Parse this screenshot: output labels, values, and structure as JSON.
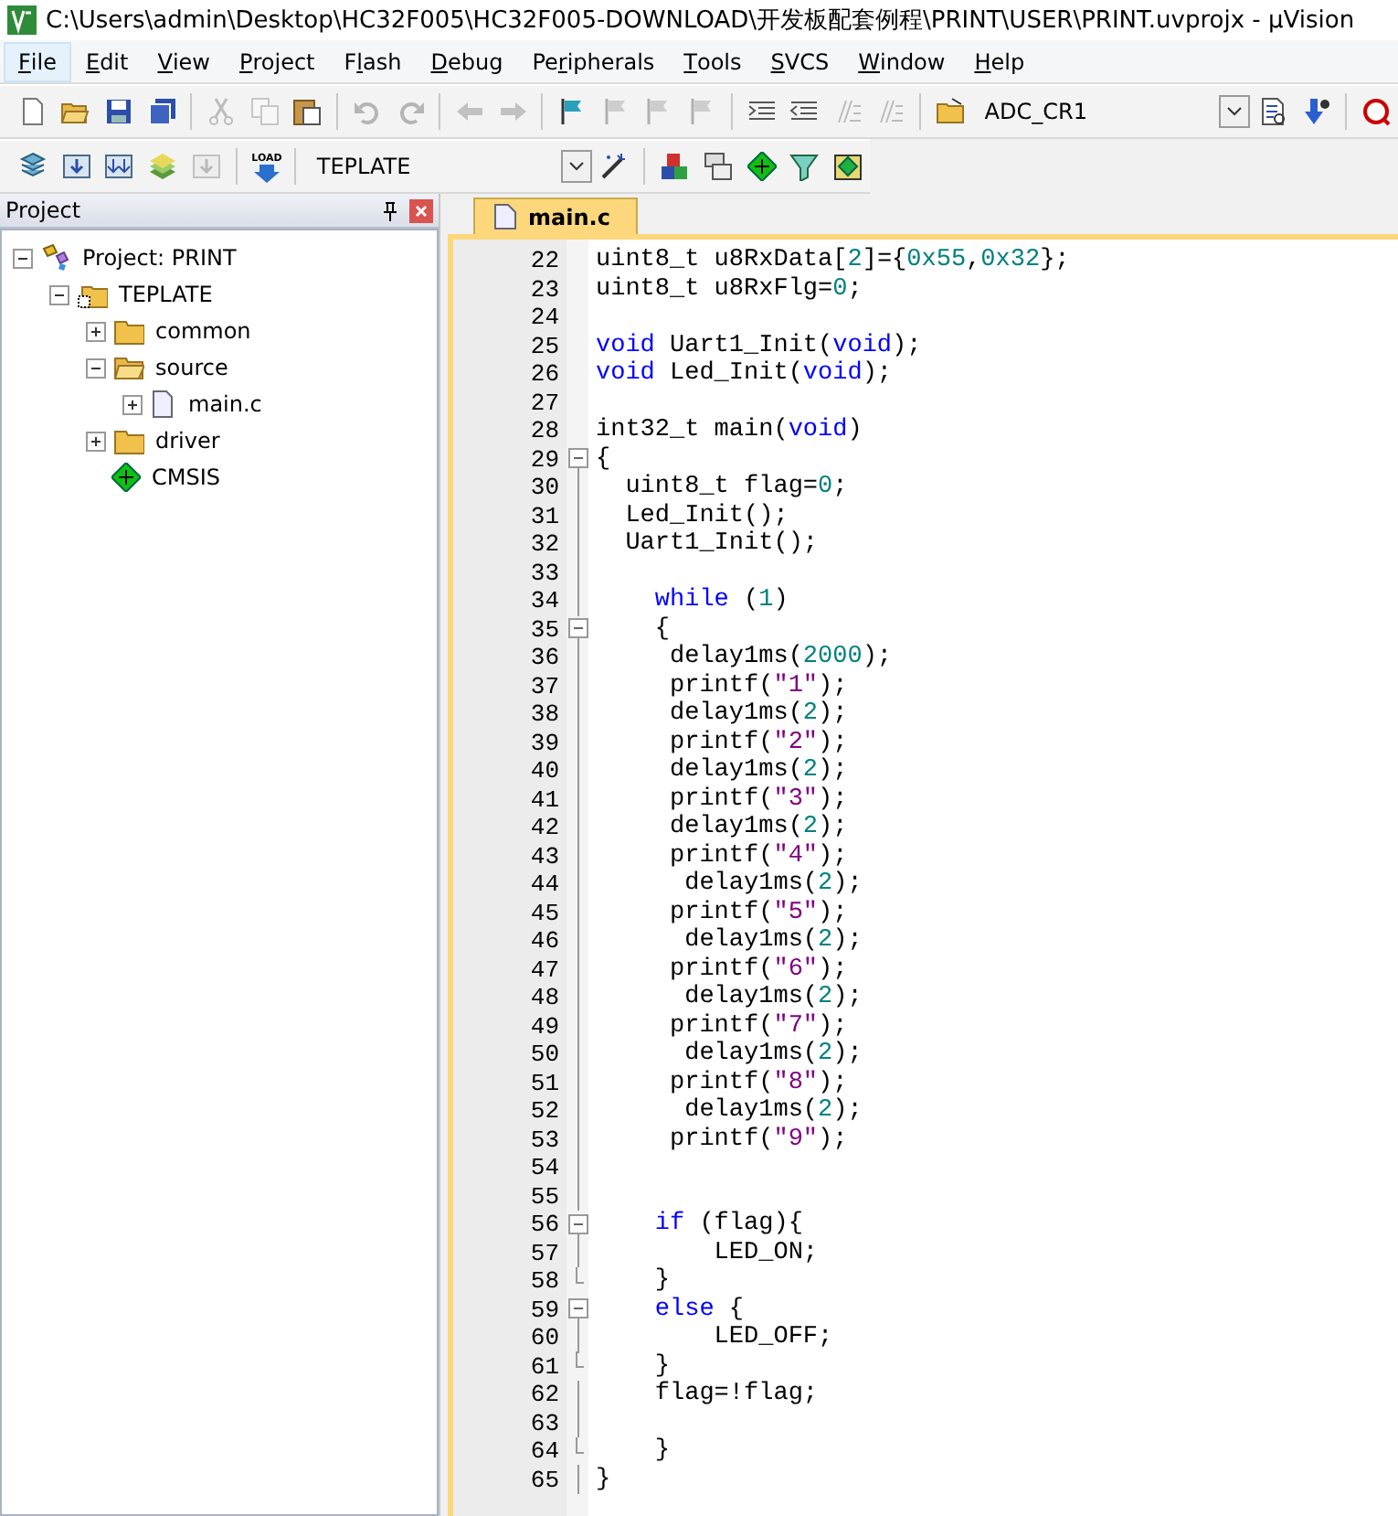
{
  "window": {
    "title": "C:\\Users\\admin\\Desktop\\HC32F005\\HC32F005-DOWNLOAD\\开发板配套例程\\PRINT\\USER\\PRINT.uvprojx - µVision"
  },
  "menu": [
    {
      "key": "F",
      "rest": "ile",
      "selected": true
    },
    {
      "key": "E",
      "rest": "dit",
      "selected": false
    },
    {
      "key": "V",
      "rest": "iew",
      "selected": false
    },
    {
      "key": "P",
      "rest": "roject",
      "selected": false
    },
    {
      "lead": "F",
      "key": "l",
      "rest": "ash",
      "selected": false
    },
    {
      "key": "D",
      "rest": "ebug",
      "selected": false
    },
    {
      "lead": "Pe",
      "key": "r",
      "rest": "ipherals",
      "selected": false
    },
    {
      "key": "T",
      "rest": "ools",
      "selected": false
    },
    {
      "key": "S",
      "rest": "VCS",
      "selected": false
    },
    {
      "key": "W",
      "rest": "indow",
      "selected": false
    },
    {
      "key": "H",
      "rest": "elp",
      "selected": false
    }
  ],
  "toolbar_1": {
    "groups": [
      [
        {
          "kind": "new",
          "disabled": false
        },
        {
          "kind": "open",
          "disabled": false
        },
        {
          "kind": "save",
          "disabled": false
        },
        {
          "kind": "saveall",
          "disabled": false
        }
      ],
      [
        {
          "kind": "cut",
          "disabled": true
        },
        {
          "kind": "copy",
          "disabled": true
        },
        {
          "kind": "paste",
          "disabled": false
        }
      ],
      [
        {
          "kind": "undo",
          "disabled": true
        },
        {
          "kind": "redo",
          "disabled": true
        }
      ],
      [
        {
          "kind": "back",
          "disabled": true
        },
        {
          "kind": "forward",
          "disabled": true
        }
      ],
      [
        {
          "kind": "flag",
          "disabled": false
        },
        {
          "kind": "flag",
          "disabled": true
        },
        {
          "kind": "flag",
          "disabled": true
        },
        {
          "kind": "flag",
          "disabled": true
        }
      ],
      [
        {
          "kind": "indent",
          "disabled": false
        },
        {
          "kind": "unindent",
          "disabled": false
        },
        {
          "kind": "comment",
          "disabled": true
        },
        {
          "kind": "comment",
          "disabled": true
        }
      ],
      [
        {
          "kind": "folder",
          "disabled": false
        }
      ]
    ],
    "combo": "ADC_CR1",
    "after": [
      {
        "kind": "findfile",
        "disabled": false
      },
      {
        "kind": "debugarrow",
        "disabled": false
      }
    ],
    "end": [
      {
        "kind": "search",
        "disabled": false
      }
    ]
  },
  "toolbar_2": {
    "groups": [
      [
        {
          "kind": "translate",
          "disabled": false
        },
        {
          "kind": "build",
          "disabled": false
        },
        {
          "kind": "rebuild",
          "disabled": false
        },
        {
          "kind": "batch",
          "disabled": false
        },
        {
          "kind": "build",
          "disabled": true
        }
      ]
    ],
    "load_label": "LOAD",
    "target": "TEPLATE",
    "after": [
      {
        "kind": "wand",
        "disabled": false
      }
    ],
    "end": [
      {
        "kind": "blocks",
        "disabled": false
      },
      {
        "kind": "windows",
        "disabled": false
      },
      {
        "kind": "diamond",
        "disabled": false
      },
      {
        "kind": "funnel",
        "disabled": false
      },
      {
        "kind": "diamondbox",
        "disabled": false
      }
    ]
  },
  "project_panel": {
    "title": "Project",
    "tree": [
      {
        "label": "Project: PRINT",
        "kind": "project",
        "expanded": true,
        "children": [
          {
            "label": "TEPLATE",
            "kind": "target",
            "expanded": true,
            "children": [
              {
                "label": "common",
                "kind": "folder",
                "expanded": false
              },
              {
                "label": "source",
                "kind": "folder",
                "expanded": true,
                "children": [
                  {
                    "label": "main.c",
                    "kind": "file",
                    "expanded": false
                  }
                ]
              },
              {
                "label": "driver",
                "kind": "folder",
                "expanded": false
              },
              {
                "label": "CMSIS",
                "kind": "component"
              }
            ]
          }
        ]
      }
    ]
  },
  "editor": {
    "tabs": [
      {
        "label": "main.c",
        "selected": true
      }
    ],
    "lines": [
      {
        "no": "22",
        "kind": "plain",
        "tokens": [
          {
            "text": "uint8_t u8RxData[",
            "kind": "plain"
          },
          {
            "text": "2",
            "kind": "number"
          },
          {
            "text": "]={",
            "kind": "plain"
          },
          {
            "text": "0x55",
            "kind": "number"
          },
          {
            "text": ",",
            "kind": "plain"
          },
          {
            "text": "0x32",
            "kind": "number"
          },
          {
            "text": "};",
            "kind": "plain"
          }
        ]
      },
      {
        "no": "23",
        "kind": "plain",
        "tokens": [
          {
            "text": "uint8_t u8RxFlg=",
            "kind": "plain"
          },
          {
            "text": "0",
            "kind": "number"
          },
          {
            "text": ";",
            "kind": "plain"
          }
        ]
      },
      {
        "no": "24",
        "kind": "plain"
      },
      {
        "no": "25",
        "kind": "plain",
        "tokens": [
          {
            "text": "void",
            "kind": "keyword"
          },
          {
            "text": " Uart1_Init(",
            "kind": "plain"
          },
          {
            "text": "void",
            "kind": "keyword"
          },
          {
            "text": ");",
            "kind": "plain"
          }
        ]
      },
      {
        "no": "26",
        "kind": "plain",
        "tokens": [
          {
            "text": "void",
            "kind": "keyword"
          },
          {
            "text": " Led_Init(",
            "kind": "plain"
          },
          {
            "text": "void",
            "kind": "keyword"
          },
          {
            "text": ");",
            "kind": "plain"
          }
        ]
      },
      {
        "no": "27",
        "kind": "plain"
      },
      {
        "no": "28",
        "kind": "plain",
        "tokens": [
          {
            "text": "int32_t main(",
            "kind": "plain"
          },
          {
            "text": "void",
            "kind": "keyword"
          },
          {
            "text": ")",
            "kind": "plain"
          }
        ]
      },
      {
        "no": "29",
        "kind": "fold-start",
        "tokens": [
          {
            "text": "{",
            "kind": "plain"
          }
        ]
      },
      {
        "no": "30",
        "kind": "fold-body",
        "tokens": [
          {
            "text": "  uint8_t flag=",
            "kind": "plain"
          },
          {
            "text": "0",
            "kind": "number"
          },
          {
            "text": ";",
            "kind": "plain"
          }
        ]
      },
      {
        "no": "31",
        "kind": "fold-body",
        "tokens": [
          {
            "text": "  Led_Init();",
            "kind": "plain"
          }
        ]
      },
      {
        "no": "32",
        "kind": "fold-body",
        "tokens": [
          {
            "text": "  Uart1_Init();",
            "kind": "plain"
          }
        ]
      },
      {
        "no": "33",
        "kind": "fold-body"
      },
      {
        "no": "34",
        "kind": "fold-body",
        "tokens": [
          {
            "text": "    while",
            "kind": "keyword"
          },
          {
            "text": " (",
            "kind": "plain"
          },
          {
            "text": "1",
            "kind": "number"
          },
          {
            "text": ")",
            "kind": "plain"
          }
        ]
      },
      {
        "no": "35",
        "kind": "fold-start",
        "tokens": [
          {
            "text": "    {",
            "kind": "plain"
          }
        ]
      },
      {
        "no": "36",
        "kind": "fold-body",
        "tokens": [
          {
            "text": "     delay1ms(",
            "kind": "plain"
          },
          {
            "text": "2000",
            "kind": "number"
          },
          {
            "text": ");",
            "kind": "plain"
          }
        ]
      },
      {
        "no": "37",
        "kind": "fold-body",
        "tokens": [
          {
            "text": "     printf(",
            "kind": "plain"
          },
          {
            "text": "\"1\"",
            "kind": "string"
          },
          {
            "text": ");",
            "kind": "plain"
          }
        ]
      },
      {
        "no": "38",
        "kind": "fold-body",
        "tokens": [
          {
            "text": "     delay1ms(",
            "kind": "plain"
          },
          {
            "text": "2",
            "kind": "number"
          },
          {
            "text": ");",
            "kind": "plain"
          }
        ]
      },
      {
        "no": "39",
        "kind": "fold-body",
        "tokens": [
          {
            "text": "     printf(",
            "kind": "plain"
          },
          {
            "text": "\"2\"",
            "kind": "string"
          },
          {
            "text": ");",
            "kind": "plain"
          }
        ]
      },
      {
        "no": "40",
        "kind": "fold-body",
        "tokens": [
          {
            "text": "     delay1ms(",
            "kind": "plain"
          },
          {
            "text": "2",
            "kind": "number"
          },
          {
            "text": ");",
            "kind": "plain"
          }
        ]
      },
      {
        "no": "41",
        "kind": "fold-body",
        "tokens": [
          {
            "text": "     printf(",
            "kind": "plain"
          },
          {
            "text": "\"3\"",
            "kind": "string"
          },
          {
            "text": ");",
            "kind": "plain"
          }
        ]
      },
      {
        "no": "42",
        "kind": "fold-body",
        "tokens": [
          {
            "text": "     delay1ms(",
            "kind": "plain"
          },
          {
            "text": "2",
            "kind": "number"
          },
          {
            "text": ");",
            "kind": "plain"
          }
        ]
      },
      {
        "no": "43",
        "kind": "fold-body",
        "tokens": [
          {
            "text": "     printf(",
            "kind": "plain"
          },
          {
            "text": "\"4\"",
            "kind": "string"
          },
          {
            "text": ");",
            "kind": "plain"
          }
        ]
      },
      {
        "no": "44",
        "kind": "fold-body",
        "tokens": [
          {
            "text": "      delay1ms(",
            "kind": "plain"
          },
          {
            "text": "2",
            "kind": "number"
          },
          {
            "text": ");",
            "kind": "plain"
          }
        ]
      },
      {
        "no": "45",
        "kind": "fold-body",
        "tokens": [
          {
            "text": "     printf(",
            "kind": "plain"
          },
          {
            "text": "\"5\"",
            "kind": "string"
          },
          {
            "text": ");",
            "kind": "plain"
          }
        ]
      },
      {
        "no": "46",
        "kind": "fold-body",
        "tokens": [
          {
            "text": "      delay1ms(",
            "kind": "plain"
          },
          {
            "text": "2",
            "kind": "number"
          },
          {
            "text": ");",
            "kind": "plain"
          }
        ]
      },
      {
        "no": "47",
        "kind": "fold-body",
        "tokens": [
          {
            "text": "     printf(",
            "kind": "plain"
          },
          {
            "text": "\"6\"",
            "kind": "string"
          },
          {
            "text": ");",
            "kind": "plain"
          }
        ]
      },
      {
        "no": "48",
        "kind": "fold-body",
        "tokens": [
          {
            "text": "      delay1ms(",
            "kind": "plain"
          },
          {
            "text": "2",
            "kind": "number"
          },
          {
            "text": ");",
            "kind": "plain"
          }
        ]
      },
      {
        "no": "49",
        "kind": "fold-body",
        "tokens": [
          {
            "text": "     printf(",
            "kind": "plain"
          },
          {
            "text": "\"7\"",
            "kind": "string"
          },
          {
            "text": ");",
            "kind": "plain"
          }
        ]
      },
      {
        "no": "50",
        "kind": "fold-body",
        "tokens": [
          {
            "text": "      delay1ms(",
            "kind": "plain"
          },
          {
            "text": "2",
            "kind": "number"
          },
          {
            "text": ");",
            "kind": "plain"
          }
        ]
      },
      {
        "no": "51",
        "kind": "fold-body",
        "tokens": [
          {
            "text": "     printf(",
            "kind": "plain"
          },
          {
            "text": "\"8\"",
            "kind": "string"
          },
          {
            "text": ");",
            "kind": "plain"
          }
        ]
      },
      {
        "no": "52",
        "kind": "fold-body",
        "tokens": [
          {
            "text": "      delay1ms(",
            "kind": "plain"
          },
          {
            "text": "2",
            "kind": "number"
          },
          {
            "text": ");",
            "kind": "plain"
          }
        ]
      },
      {
        "no": "53",
        "kind": "fold-body",
        "tokens": [
          {
            "text": "     printf(",
            "kind": "plain"
          },
          {
            "text": "\"9\"",
            "kind": "string"
          },
          {
            "text": ");",
            "kind": "plain"
          }
        ]
      },
      {
        "no": "54",
        "kind": "fold-body"
      },
      {
        "no": "55",
        "kind": "fold-body"
      },
      {
        "no": "56",
        "kind": "fold-start",
        "tokens": [
          {
            "text": "    if",
            "kind": "keyword"
          },
          {
            "text": " (flag){",
            "kind": "plain"
          }
        ]
      },
      {
        "no": "57",
        "kind": "fold-body",
        "tokens": [
          {
            "text": "        LED_ON;",
            "kind": "plain"
          }
        ]
      },
      {
        "no": "58",
        "kind": "fold-end",
        "tokens": [
          {
            "text": "    }",
            "kind": "plain"
          }
        ]
      },
      {
        "no": "59",
        "kind": "fold-start",
        "tokens": [
          {
            "text": "    else",
            "kind": "keyword"
          },
          {
            "text": " {",
            "kind": "plain"
          }
        ]
      },
      {
        "no": "60",
        "kind": "fold-body",
        "tokens": [
          {
            "text": "        LED_OFF;",
            "kind": "plain"
          }
        ]
      },
      {
        "no": "61",
        "kind": "fold-end",
        "tokens": [
          {
            "text": "    }",
            "kind": "plain"
          }
        ]
      },
      {
        "no": "62",
        "kind": "fold-body",
        "tokens": [
          {
            "text": "    flag=!flag;",
            "kind": "plain"
          }
        ]
      },
      {
        "no": "63",
        "kind": "fold-body"
      },
      {
        "no": "64",
        "kind": "fold-end",
        "tokens": [
          {
            "text": "    }",
            "kind": "plain"
          }
        ]
      },
      {
        "no": "65",
        "kind": "fold-body",
        "tokens": [
          {
            "text": "}",
            "kind": "plain"
          }
        ]
      }
    ]
  }
}
